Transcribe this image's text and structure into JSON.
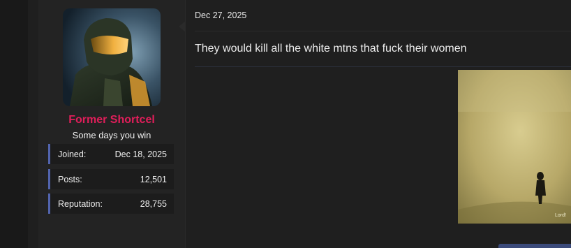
{
  "user": {
    "name": "Former Shortcel",
    "title": "Some days you win",
    "name_color": "#e01e5a",
    "stats": [
      {
        "label": "Joined:",
        "value": "Dec 18, 2025"
      },
      {
        "label": "Posts:",
        "value": "12,501"
      },
      {
        "label": "Reputation:",
        "value": "28,755"
      }
    ]
  },
  "post": {
    "date": "Dec 27, 2025",
    "text": "They would kill all the white mtns that fuck their women",
    "image_watermark": "Lord!"
  },
  "colors": {
    "background": "#1f1f1f",
    "sidebar": "#232323",
    "stat_accent": "#5264ae"
  }
}
